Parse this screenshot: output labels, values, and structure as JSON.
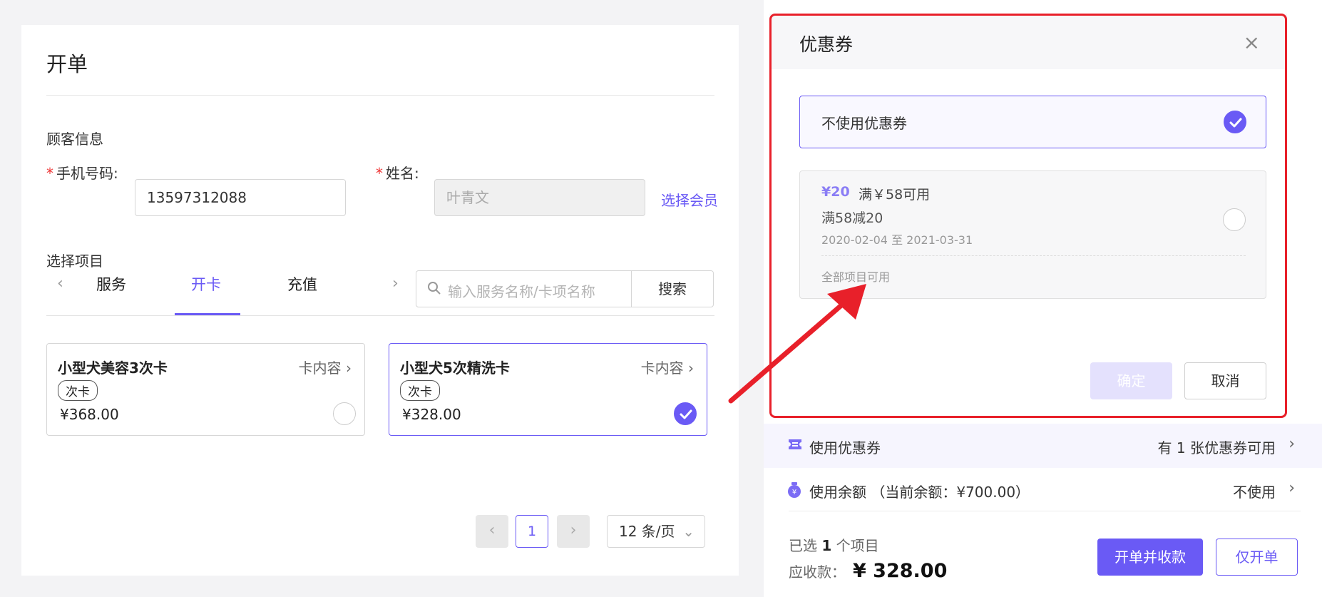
{
  "colors": {
    "accent": "#6a5af5",
    "annotation": "#e8202a"
  },
  "order": {
    "title": "开单",
    "customer_section": "顾客信息",
    "phone_label": "手机号码:",
    "phone_value": "13597312088",
    "name_label": "姓名:",
    "name_placeholder": "叶青文",
    "select_member": "选择会员",
    "items_section": "选择项目",
    "tabs": [
      {
        "label": "服务"
      },
      {
        "label": "开卡",
        "active": true
      },
      {
        "label": "充值"
      }
    ],
    "search_placeholder": "输入服务名称/卡项名称",
    "search_button": "搜索",
    "cards": [
      {
        "name": "小型犬美容3次卡",
        "detail_link": "卡内容",
        "tag": "次卡",
        "price": "¥368.00",
        "selected": false
      },
      {
        "name": "小型犬5次精洗卡",
        "detail_link": "卡内容",
        "tag": "次卡",
        "price": "¥328.00",
        "selected": true
      }
    ],
    "pagination": {
      "current_page": "1",
      "page_size": "12 条/页"
    }
  },
  "coupon_modal": {
    "title": "优惠券",
    "no_coupon_label": "不使用优惠券",
    "no_coupon_selected": true,
    "coupon": {
      "amount": "¥20",
      "condition": "满￥58可用",
      "name": "满58减20",
      "validity": "2020-02-04 至 2021-03-31",
      "scope": "全部项目可用"
    },
    "confirm": "确定",
    "cancel": "取消"
  },
  "checkout": {
    "coupon_row_label": "使用优惠券",
    "coupon_row_value": "有 1 张优惠券可用",
    "balance_row_label": "使用余额 （当前余额：¥700.00）",
    "balance_row_value": "不使用",
    "selected_prefix": "已选",
    "selected_count": "1",
    "selected_suffix": "个项目",
    "receivable_label": "应收款：",
    "receivable_amount": "¥ 328.00",
    "primary_button": "开单并收款",
    "secondary_button": "仅开单"
  }
}
